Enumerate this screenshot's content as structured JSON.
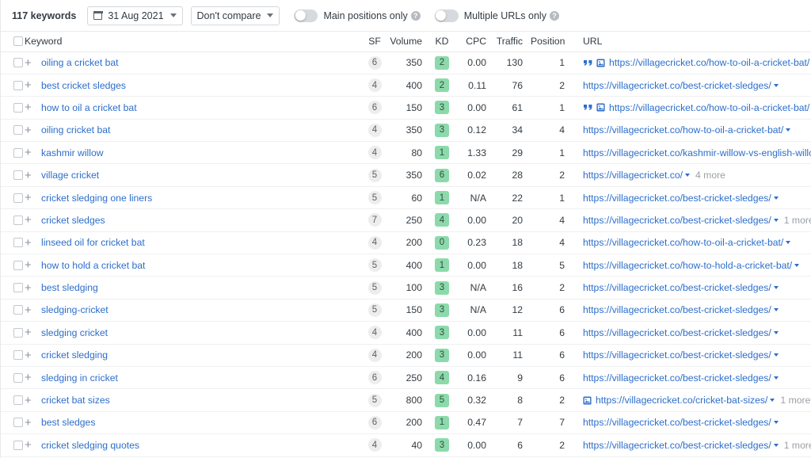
{
  "toolbar": {
    "keyword_count": "117 keywords",
    "date_picker": {
      "icon": "calendar-icon",
      "value": "31 Aug 2021"
    },
    "compare_select": {
      "value": "Don't compare"
    },
    "toggles": [
      {
        "label": "Main positions only",
        "state": "off",
        "help_icon": "question-mark-icon"
      },
      {
        "label": "Multiple URLs only",
        "state": "off",
        "help_icon": "question-mark-icon"
      }
    ]
  },
  "table": {
    "columns": [
      "Keyword",
      "SF",
      "Volume",
      "KD",
      "CPC",
      "Traffic",
      "Position",
      "URL"
    ],
    "accent_link_color": "#2c6ecb",
    "kd_badge_color": "#8cdaab",
    "sf_badge_color": "#ededed",
    "rows": [
      {
        "keyword": "oiling a cricket bat",
        "sf": "6",
        "volume": "350",
        "kd": "2",
        "cpc": "0.00",
        "traffic": "130",
        "position": "1",
        "url": "https://villagecricket.co/how-to-oil-a-cricket-bat/",
        "more": "",
        "icons": [
          "featured-snippet-icon",
          "image-pack-icon"
        ]
      },
      {
        "keyword": "best cricket sledges",
        "sf": "4",
        "volume": "400",
        "kd": "2",
        "cpc": "0.11",
        "traffic": "76",
        "position": "2",
        "url": "https://villagecricket.co/best-cricket-sledges/",
        "more": "",
        "icons": []
      },
      {
        "keyword": "how to oil a cricket bat",
        "sf": "6",
        "volume": "150",
        "kd": "3",
        "cpc": "0.00",
        "traffic": "61",
        "position": "1",
        "url": "https://villagecricket.co/how-to-oil-a-cricket-bat/",
        "more": "",
        "icons": [
          "featured-snippet-icon",
          "image-pack-icon"
        ]
      },
      {
        "keyword": "oiling cricket bat",
        "sf": "4",
        "volume": "350",
        "kd": "3",
        "cpc": "0.12",
        "traffic": "34",
        "position": "4",
        "url": "https://villagecricket.co/how-to-oil-a-cricket-bat/",
        "more": "",
        "icons": []
      },
      {
        "keyword": "kashmir willow",
        "sf": "4",
        "volume": "80",
        "kd": "1",
        "cpc": "1.33",
        "traffic": "29",
        "position": "1",
        "url": "https://villagecricket.co/kashmir-willow-vs-english-willow/",
        "more": "",
        "icons": []
      },
      {
        "keyword": "village cricket",
        "sf": "5",
        "volume": "350",
        "kd": "6",
        "cpc": "0.02",
        "traffic": "28",
        "position": "2",
        "url": "https://villagecricket.co/",
        "more": "4 more",
        "icons": []
      },
      {
        "keyword": "cricket sledging one liners",
        "sf": "5",
        "volume": "60",
        "kd": "1",
        "cpc": "N/A",
        "traffic": "22",
        "position": "1",
        "url": "https://villagecricket.co/best-cricket-sledges/",
        "more": "",
        "icons": []
      },
      {
        "keyword": "cricket sledges",
        "sf": "7",
        "volume": "250",
        "kd": "4",
        "cpc": "0.00",
        "traffic": "20",
        "position": "4",
        "url": "https://villagecricket.co/best-cricket-sledges/",
        "more": "1 more",
        "icons": []
      },
      {
        "keyword": "linseed oil for cricket bat",
        "sf": "4",
        "volume": "200",
        "kd": "0",
        "cpc": "0.23",
        "traffic": "18",
        "position": "4",
        "url": "https://villagecricket.co/how-to-oil-a-cricket-bat/",
        "more": "",
        "icons": []
      },
      {
        "keyword": "how to hold a cricket bat",
        "sf": "5",
        "volume": "400",
        "kd": "1",
        "cpc": "0.00",
        "traffic": "18",
        "position": "5",
        "url": "https://villagecricket.co/how-to-hold-a-cricket-bat/",
        "more": "",
        "icons": []
      },
      {
        "keyword": "best sledging",
        "sf": "5",
        "volume": "100",
        "kd": "3",
        "cpc": "N/A",
        "traffic": "16",
        "position": "2",
        "url": "https://villagecricket.co/best-cricket-sledges/",
        "more": "",
        "icons": []
      },
      {
        "keyword": "sledging-cricket",
        "sf": "5",
        "volume": "150",
        "kd": "3",
        "cpc": "N/A",
        "traffic": "12",
        "position": "6",
        "url": "https://villagecricket.co/best-cricket-sledges/",
        "more": "",
        "icons": []
      },
      {
        "keyword": "sledging cricket",
        "sf": "4",
        "volume": "400",
        "kd": "3",
        "cpc": "0.00",
        "traffic": "11",
        "position": "6",
        "url": "https://villagecricket.co/best-cricket-sledges/",
        "more": "",
        "icons": []
      },
      {
        "keyword": "cricket sledging",
        "sf": "4",
        "volume": "200",
        "kd": "3",
        "cpc": "0.00",
        "traffic": "11",
        "position": "6",
        "url": "https://villagecricket.co/best-cricket-sledges/",
        "more": "",
        "icons": []
      },
      {
        "keyword": "sledging in cricket",
        "sf": "6",
        "volume": "250",
        "kd": "4",
        "cpc": "0.16",
        "traffic": "9",
        "position": "6",
        "url": "https://villagecricket.co/best-cricket-sledges/",
        "more": "",
        "icons": []
      },
      {
        "keyword": "cricket bat sizes",
        "sf": "5",
        "volume": "800",
        "kd": "5",
        "cpc": "0.32",
        "traffic": "8",
        "position": "2",
        "url": "https://villagecricket.co/cricket-bat-sizes/",
        "more": "1 more",
        "icons": [
          "image-pack-icon"
        ]
      },
      {
        "keyword": "best sledges",
        "sf": "6",
        "volume": "200",
        "kd": "1",
        "cpc": "0.47",
        "traffic": "7",
        "position": "7",
        "url": "https://villagecricket.co/best-cricket-sledges/",
        "more": "",
        "icons": []
      },
      {
        "keyword": "cricket sledging quotes",
        "sf": "4",
        "volume": "40",
        "kd": "3",
        "cpc": "0.00",
        "traffic": "6",
        "position": "2",
        "url": "https://villagecricket.co/best-cricket-sledges/",
        "more": "1 more",
        "icons": []
      }
    ]
  }
}
